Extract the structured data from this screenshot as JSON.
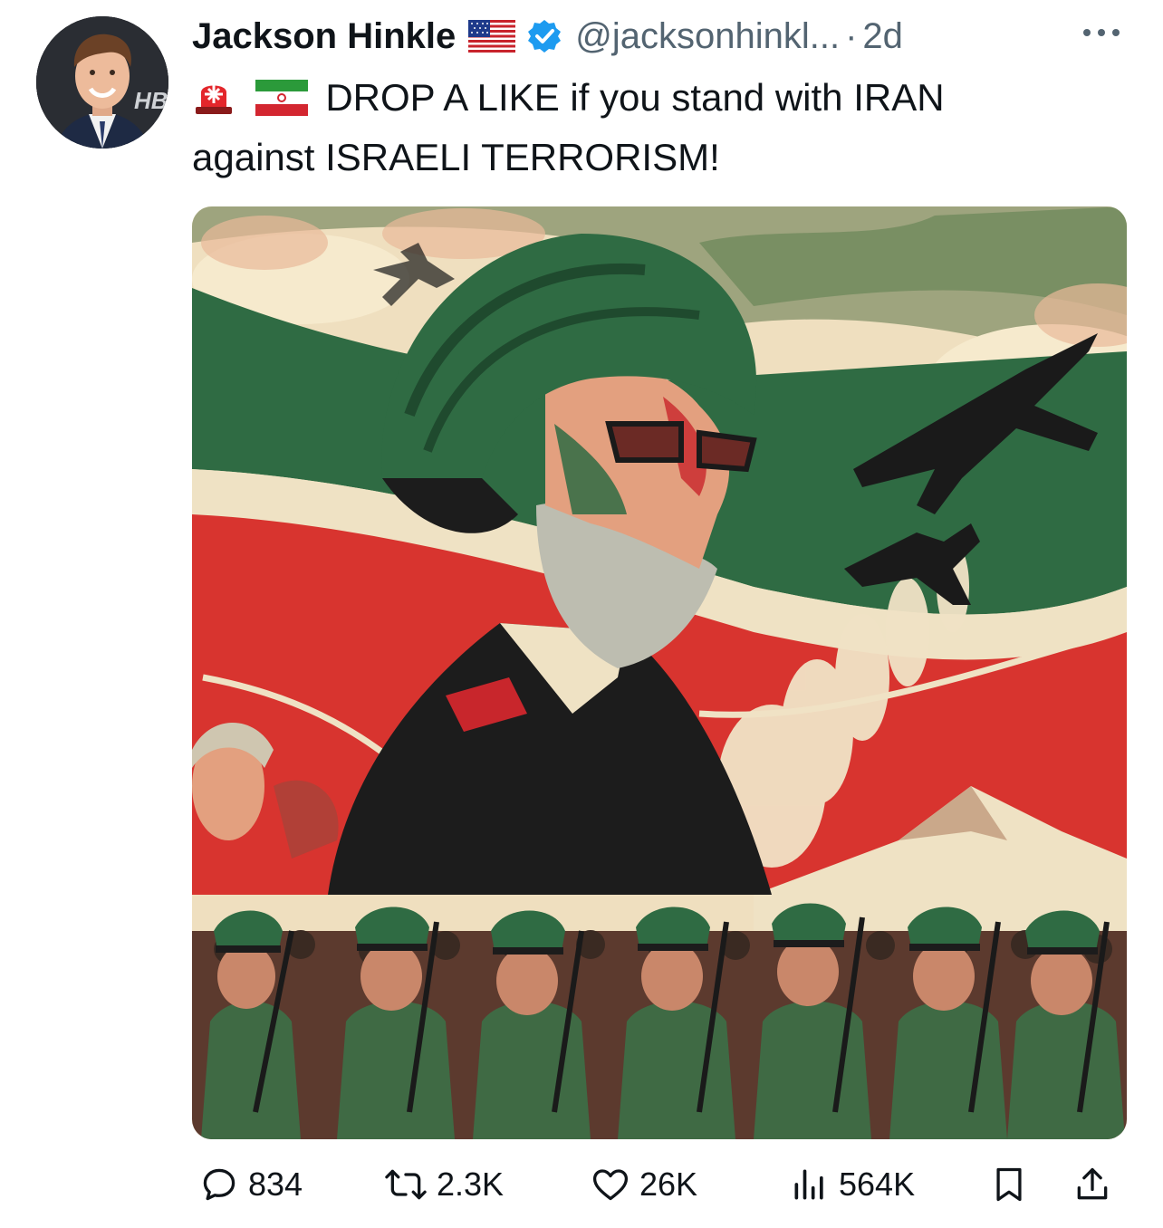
{
  "post": {
    "author_name": "Jackson Hinkle",
    "handle": "@jacksonhinkl...",
    "separator": "·",
    "timestamp": "2d",
    "text_line1": "DROP A LIKE if you stand with IRAN",
    "text_line2": "against ISRAELI TERRORISM!",
    "avatar_badge": "HB"
  },
  "icons": {
    "flag": "us-flag-icon",
    "verified": "verified-badge-icon",
    "more": "more-options-icon",
    "siren": "police-light-icon",
    "iran_flag": "iran-flag-icon"
  },
  "stats": {
    "replies": "834",
    "reposts": "2.3K",
    "likes": "26K",
    "views": "564K"
  },
  "colors": {
    "verified_blue": "#1d9bf0",
    "muted_text": "#536471",
    "iran_green": "#2f6b43",
    "iran_red": "#d8342f",
    "poster_cream": "#efdfbf"
  }
}
